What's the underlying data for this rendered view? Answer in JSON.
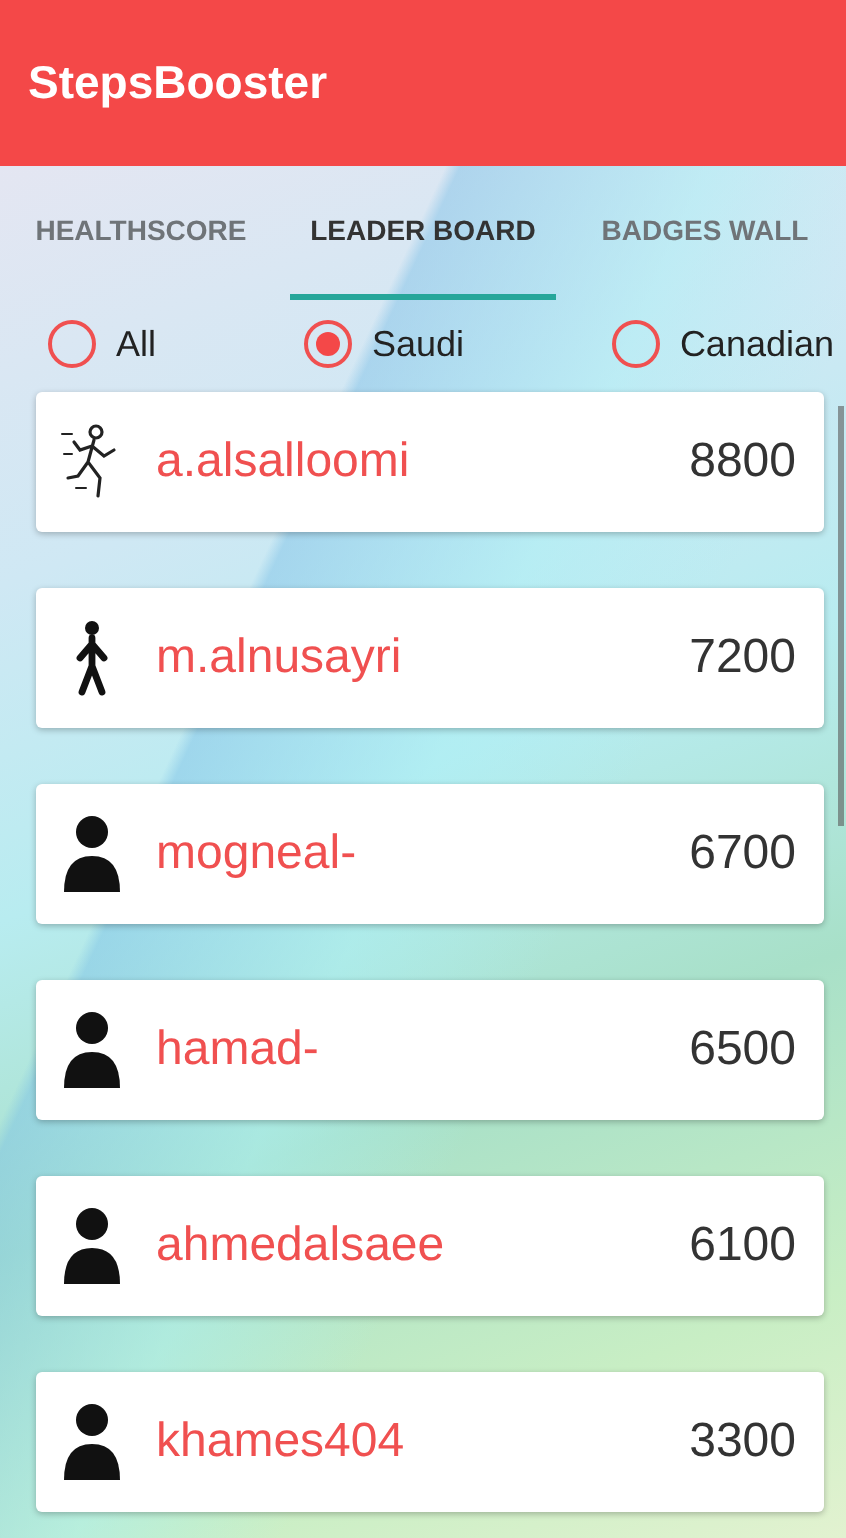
{
  "app_bar": {
    "title": "StepsBooster"
  },
  "tabs": [
    {
      "label": "HEALTHSCORE",
      "selected": false
    },
    {
      "label": "LEADER BOARD",
      "selected": true
    },
    {
      "label": "BADGES WALL",
      "selected": false
    }
  ],
  "filters": [
    {
      "label": "All",
      "selected": false
    },
    {
      "label": "Saudi",
      "selected": true
    },
    {
      "label": "Canadian",
      "selected": false
    }
  ],
  "leaderboard": [
    {
      "kind": "runner",
      "name": "a.alsalloomi",
      "score": "8800"
    },
    {
      "kind": "walker",
      "name": "m.alnusayri",
      "score": "7200"
    },
    {
      "kind": "person",
      "name": "mogneal-",
      "score": "6700"
    },
    {
      "kind": "person",
      "name": "hamad-",
      "score": "6500"
    },
    {
      "kind": "person",
      "name": "ahmedalsaee",
      "score": "6100"
    },
    {
      "kind": "person",
      "name": "khames404",
      "score": "3300"
    }
  ]
}
